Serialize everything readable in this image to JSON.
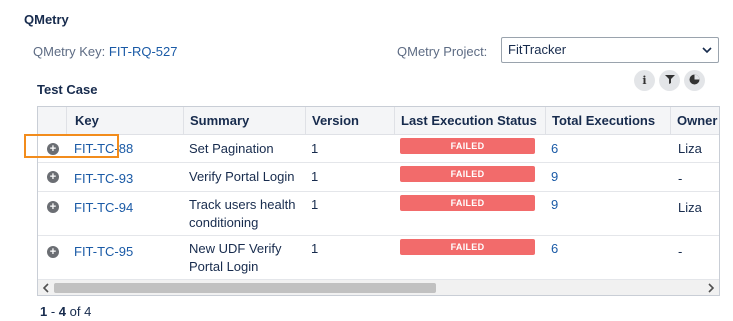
{
  "section": {
    "title": "QMetry"
  },
  "key": {
    "label": "QMetry Key:",
    "value": "FIT-RQ-527"
  },
  "project": {
    "label": "QMetry Project:",
    "selected": "FitTracker"
  },
  "test_case": {
    "title": "Test Case",
    "toolbar": [
      {
        "icon": "info-icon",
        "glyph": "i"
      },
      {
        "icon": "filter-icon",
        "glyph": "▼"
      },
      {
        "icon": "pie-chart-icon",
        "glyph": "◕"
      }
    ],
    "columns": [
      "Key",
      "Summary",
      "Version",
      "Last Execution Status",
      "Total Executions",
      "Owner"
    ],
    "rows": [
      {
        "key": "FIT-TC-88",
        "summary_line1": "Set Pagination",
        "summary_line2": "",
        "version": "1",
        "status": "FAILED",
        "executions": "6",
        "owner": "Liza"
      },
      {
        "key": "FIT-TC-93",
        "summary_line1": "Verify Portal Login",
        "summary_line2": "",
        "version": "1",
        "status": "FAILED",
        "executions": "9",
        "owner": "-"
      },
      {
        "key": "FIT-TC-94",
        "summary_line1": "Track users health",
        "summary_line2": "conditioning",
        "version": "1",
        "status": "FAILED",
        "executions": "9",
        "owner": "Liza"
      },
      {
        "key": "FIT-TC-95",
        "summary_line1": "New UDF Verify",
        "summary_line2": "Portal Login",
        "version": "1",
        "status": "FAILED",
        "executions": "6",
        "owner": "-"
      }
    ]
  },
  "pager": {
    "start": "1",
    "sep": " - ",
    "end": "4",
    "of": " of 4"
  },
  "colors": {
    "failed": "#f26b6b",
    "link": "#1a5aa6",
    "focus": "#f28c1c"
  }
}
